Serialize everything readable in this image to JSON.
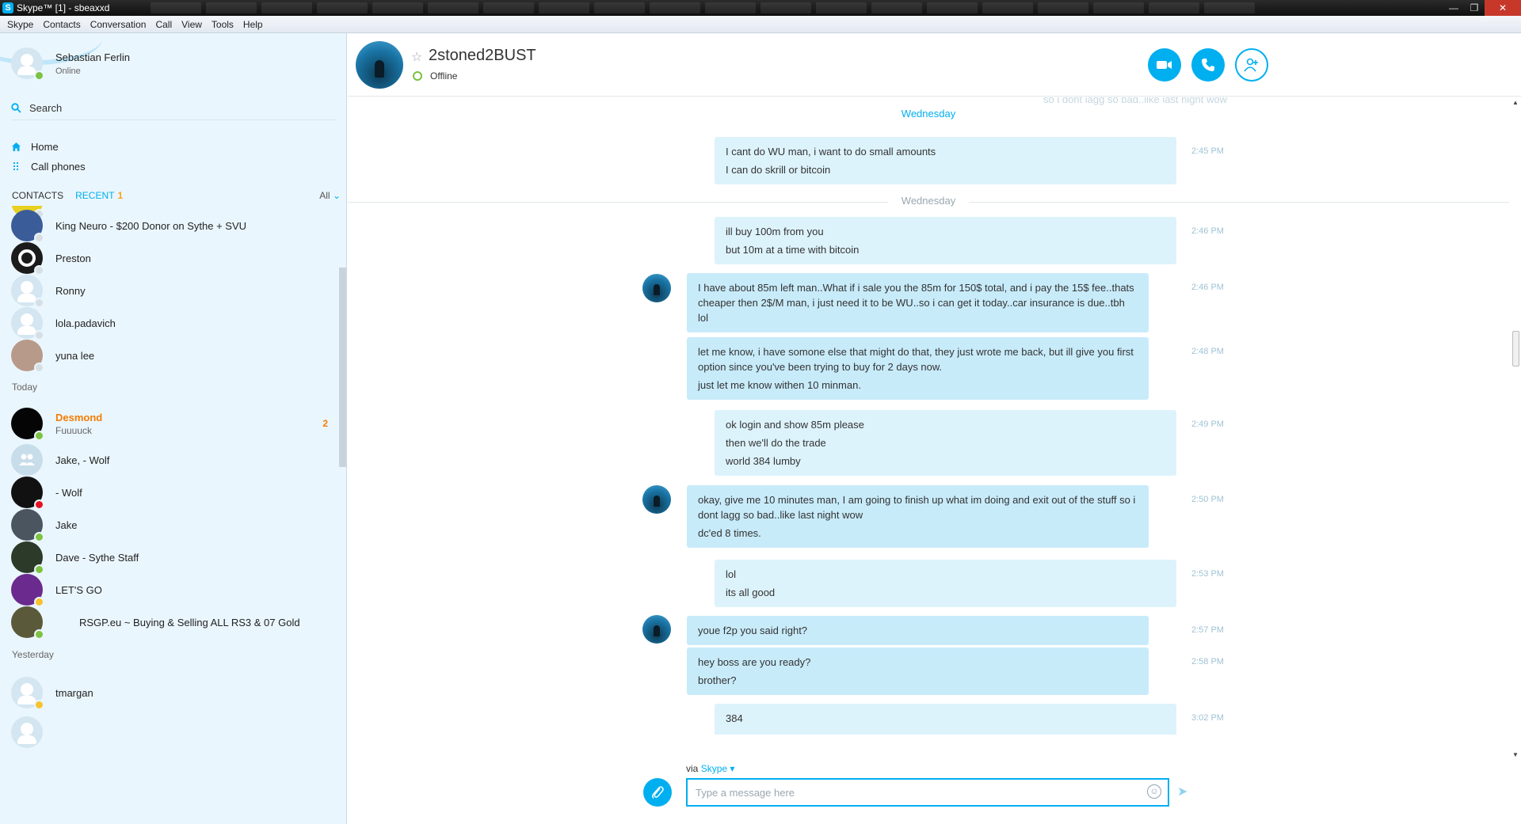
{
  "window": {
    "title": "Skype™ [1] - sbeaxxd"
  },
  "menu": [
    "Skype",
    "Contacts",
    "Conversation",
    "Call",
    "View",
    "Tools",
    "Help"
  ],
  "profile": {
    "name": "Sebastian Ferlin",
    "status": "Online"
  },
  "search": {
    "label": "Search"
  },
  "nav": {
    "home": "Home",
    "call_phones": "Call phones"
  },
  "tabs": {
    "contacts": "CONTACTS",
    "recent": "RECENT",
    "recent_count": "1",
    "filter": "All"
  },
  "contacts_top": [
    {
      "name": "King Neuro - $200 Donor on Sythe + SVU",
      "presence": "unknown",
      "avatar_color": "#3a5d99"
    },
    {
      "name": "Preston",
      "presence": "unknown",
      "avatar_color": "#1b1b1b"
    },
    {
      "name": "Ronny",
      "presence": "unknown",
      "avatar_color": "#d3e6f1"
    },
    {
      "name": "lola.padavich",
      "presence": "unknown",
      "avatar_color": "#d3e6f1"
    },
    {
      "name": "yuna lee",
      "presence": "unknown",
      "avatar_color": "#b89a8a"
    }
  ],
  "section_today": "Today",
  "contacts_today": [
    {
      "name": "Desmond",
      "snippet": "Fuuuuck",
      "badge": "2",
      "unread": true,
      "presence": "online",
      "avatar_color": "#050505"
    },
    {
      "name": "Jake, - Wolf",
      "presence": "none",
      "avatar_color": "#c7dde9"
    },
    {
      "name": "- Wolf",
      "presence": "busy",
      "avatar_color": "#111111"
    },
    {
      "name": "Jake",
      "presence": "online",
      "avatar_color": "#4a5560"
    },
    {
      "name": "Dave - Sythe Staff",
      "presence": "online",
      "avatar_color": "#2c3a2a"
    },
    {
      "name": "LET'S GO",
      "presence": "away",
      "avatar_color": "#6b2a8e"
    },
    {
      "name": "RSGP.eu ~ Buying & Selling ALL RS3 & 07 Gold",
      "presence": "online",
      "avatar_color": "#5a5a3a"
    }
  ],
  "section_yesterday": "Yesterday",
  "contacts_yesterday": [
    {
      "name": "tmargan",
      "presence": "away",
      "avatar_color": "#d3e6f1"
    }
  ],
  "conversation": {
    "name": "2stoned2BUST",
    "status": "Offline",
    "buttons": [
      "video-call",
      "audio-call",
      "add-people"
    ]
  },
  "messages": {
    "faded_top": "so i dont lagg so bad..like last night wow",
    "day1": "Wednesday",
    "day2": "Wednesday",
    "m1": {
      "lines": [
        "I cant do WU man, i want to do small amounts",
        "I can do skrill or bitcoin"
      ],
      "time": "2:45 PM"
    },
    "m2": {
      "lines": [
        "ill buy 100m from you",
        "but 10m at a time with bitcoin"
      ],
      "time": "2:46 PM"
    },
    "m3": {
      "lines": [
        "I have about 85m left man..What if i sale you the 85m for 150$ total, and i pay the 15$ fee..thats cheaper then 2$/M man, i just need it to be WU..so i can get it today..car insurance is due..tbh lol"
      ],
      "time": "2:46 PM"
    },
    "m4": {
      "lines": [
        "let me know, i have somone else that might do that, they just wrote me back, but ill give you first option since you've been trying to buy for 2 days now.",
        "just let me know withen 10 minman."
      ],
      "time": "2:48 PM"
    },
    "m5": {
      "lines": [
        "ok login and show 85m please",
        "then we'll do the trade",
        "world 384 lumby"
      ],
      "time": "2:49 PM"
    },
    "m6": {
      "lines": [
        "okay, give me 10 minutes man, I am going to finish up what im doing and exit out of the stuff so i dont lagg so bad..like last night wow",
        "dc'ed 8 times."
      ],
      "time": "2:50 PM"
    },
    "m7": {
      "lines": [
        "lol",
        "its all good"
      ],
      "time": "2:53 PM"
    },
    "m8": {
      "lines": [
        "youe f2p you said right?"
      ],
      "time": "2:57 PM"
    },
    "m9": {
      "lines": [
        "hey boss are you ready?",
        "brother?"
      ],
      "time": "2:58 PM"
    },
    "m10": {
      "lines": [
        "384"
      ],
      "time": "3:02 PM"
    }
  },
  "composer": {
    "via_label": "via",
    "via_service": "Skype",
    "placeholder": "Type a message here"
  }
}
